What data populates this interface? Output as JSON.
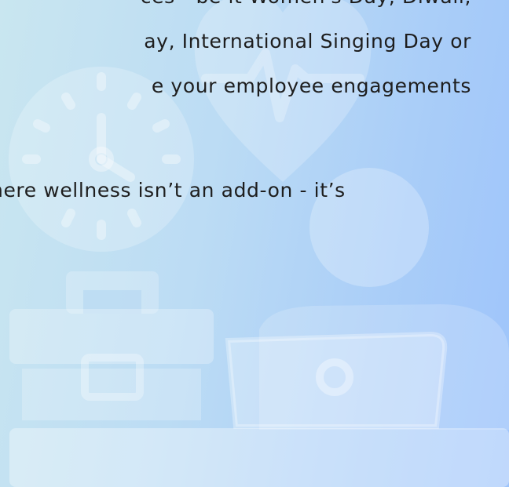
{
  "colors": {
    "gradient_start": "#c9e6f0",
    "gradient_end": "#9ec4fb",
    "illustration": "#ffffff",
    "text": "#1e1e1e"
  },
  "illustration": {
    "icons": [
      "clock-icon",
      "heart-pulse-icon",
      "person-head-icon",
      "briefcase-icon",
      "laptop-icon",
      "desk-icon"
    ]
  },
  "paragraph": {
    "line1": "ces - be it Women's Day, Diwali,",
    "line2": "ay, International Singing Day or",
    "line3": "e your employee engagements",
    "line4": ".",
    "line5": "here wellness isn’t an add-on - it’s"
  }
}
